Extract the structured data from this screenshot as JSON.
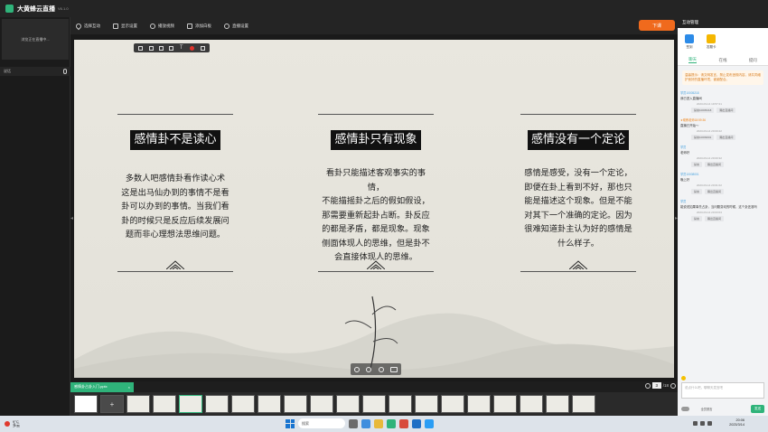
{
  "app": {
    "name": "大黄蜂云直播",
    "version": "V6.1.0"
  },
  "left": {
    "preview_text": "浏览正在直播中...",
    "mic_label": "说话"
  },
  "toolbar": {
    "items": [
      "选择互动",
      "显示设置",
      "播放视频",
      "添加白板",
      "直播设置"
    ],
    "start_label": "下课"
  },
  "slide": {
    "cards": [
      {
        "title": "感情卦不是读心",
        "body": [
          "多数人吧感情卦看作读心术",
          "这是出马仙办到的事情不是看",
          "卦可以办到的事情。当我们看",
          "卦的时候只是反应后续发展问",
          "题而非心理想法思维问题。"
        ]
      },
      {
        "title": "感情卦只有现象",
        "body": [
          "看卦只能描述客观事实的事情，",
          "不能描摇卦之后的假如假设，",
          "那需要重新起卦占断。卦反应",
          "的都是矛盾，都是现象。现象",
          "侧面体现人的思维，但是卦不",
          "会直接体现人的思维。"
        ]
      },
      {
        "title": "感情没有一个定论",
        "body": [
          "感情是感受，没有一个定论，",
          "即便在卦上看到不好，那也只",
          "能是描述这个现象。但是不能",
          "对其下一个准确的定论。因为",
          "很难知道卦主认为好的感情是",
          "什么样子。"
        ]
      }
    ]
  },
  "file_tab": {
    "name": "感情卦占卦入门.pptx",
    "close": "×"
  },
  "pager": {
    "current": "3",
    "total": "/18"
  },
  "thumbs": {
    "add_label": "+",
    "count": 20,
    "active_index": 4
  },
  "right": {
    "header": "互动管理",
    "icons": [
      {
        "label": "签到",
        "color": "#2c8be8"
      },
      {
        "label": "答题卡",
        "color": "#f5b700"
      }
    ],
    "tabs": [
      "聊天",
      "在线",
      "提问"
    ],
    "notice": "温馨提示：请文明发言，禁止发布违规内容，请共同维护良好的直播环境，谢谢配合。",
    "messages": [
      {
        "who": "学员10005218",
        "text": "我已进入直播间",
        "time": "2023-03-14 19:57:21",
        "acts": [
          "禁言10005218",
          "踢出直播间"
        ],
        "orange": false
      },
      {
        "who": "★助教老师18:59:36",
        "text": "直播已开始～",
        "time": "2023-03-14 20:00:22",
        "acts": [
          "禁言10009001",
          "踢出直播间"
        ],
        "orange": true
      },
      {
        "who": "学员",
        "text": "老师好",
        "time": "2023-03-14 20:00:32",
        "acts": [
          "禁言",
          "踢出直播间"
        ],
        "orange": false
      },
      {
        "who": "学员10008001",
        "text": "晚上好",
        "time": "2023-03-14 20:01:02",
        "acts": [
          "禁言",
          "踢出直播间"
        ],
        "orange": false
      },
      {
        "who": "学员",
        "text": "能说说如果事先占卦，当问题变动的时候，这个卦还准吗",
        "time": "2023-03-14 20:03:04",
        "acts": [
          "禁言",
          "踢出直播间"
        ],
        "orange": false
      }
    ],
    "input_placeholder": "说点什么吧，聊聊天发言吧",
    "bottom_label": "全员禁言",
    "send_label": "发送"
  },
  "taskbar": {
    "weather_temp": "9°C",
    "weather_text": "多云",
    "search_placeholder": "搜索",
    "time": "20:06",
    "date": "2023/3/14"
  }
}
